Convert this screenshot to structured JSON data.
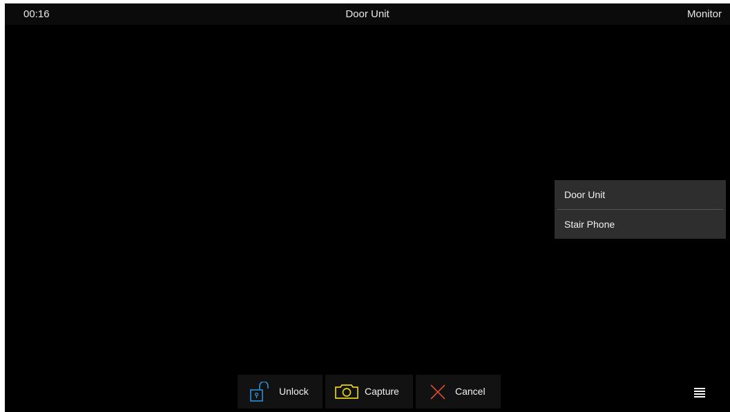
{
  "header": {
    "clock": "00:16",
    "title": "Door Unit",
    "mode": "Monitor"
  },
  "device_menu": {
    "items": [
      {
        "label": "Door Unit"
      },
      {
        "label": "Stair Phone"
      }
    ]
  },
  "actions": {
    "unlock": {
      "label": "Unlock",
      "icon": "unlock-icon",
      "color": "#2b8fd6"
    },
    "capture": {
      "label": "Capture",
      "icon": "camera-icon",
      "color": "#e6d21a"
    },
    "cancel": {
      "label": "Cancel",
      "icon": "close-icon",
      "color": "#e04a3b"
    }
  },
  "menu_button": {
    "icon": "menu-icon"
  },
  "colors": {
    "background": "#000000",
    "header_background": "#0b0b0b",
    "menu_background": "#2e2e2e",
    "text": "#f2f2f2"
  }
}
